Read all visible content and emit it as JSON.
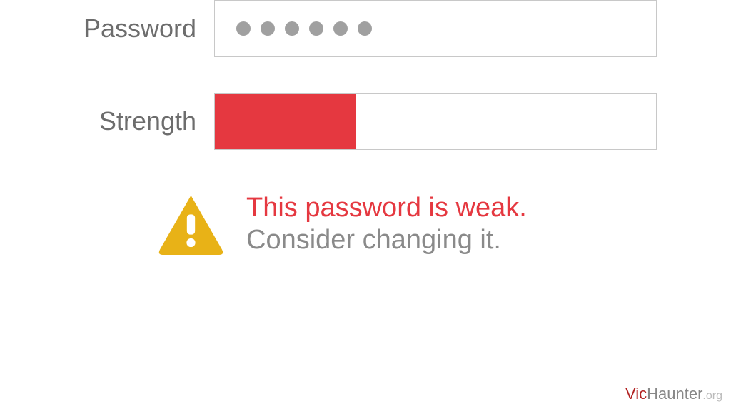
{
  "form": {
    "password_label": "Password",
    "password_dot_count": 6,
    "strength_label": "Strength",
    "strength_percent": 32,
    "strength_color": "#e53840"
  },
  "warning": {
    "primary": "This password is weak.",
    "secondary": "Consider changing it.",
    "icon_color": "#e8b217"
  },
  "watermark": {
    "brand": "Vic",
    "name": "Haunter",
    "tld": ".org"
  }
}
